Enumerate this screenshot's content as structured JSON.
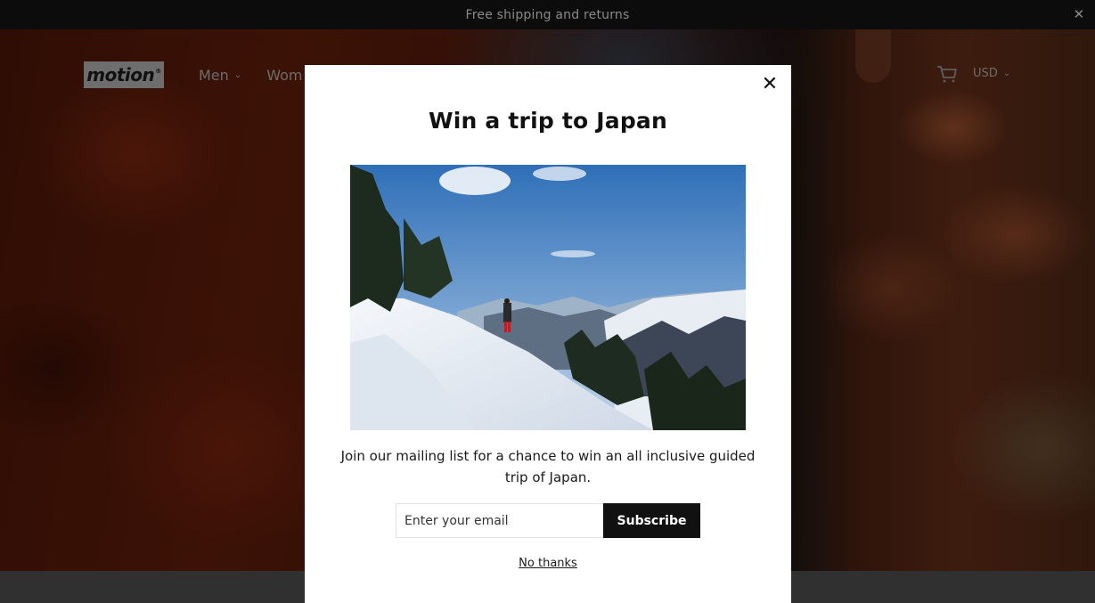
{
  "announcement": {
    "text": "Free shipping and returns",
    "close_icon": "close-icon"
  },
  "header": {
    "logo_text": "motion",
    "logo_mark": "®",
    "nav": [
      {
        "label": "Men",
        "icon": "chevron-down-icon"
      },
      {
        "label": "Wom",
        "icon": ""
      }
    ],
    "cart_icon": "cart-icon",
    "currency": "USD"
  },
  "modal": {
    "title": "Win a trip to Japan",
    "image_alt_icon": "mountain-hiker-photo",
    "description": "Join our mailing list for a chance to win an all inclusive guided trip of Japan.",
    "email_placeholder": "Enter your email",
    "email_value": "",
    "subscribe_label": "Subscribe",
    "dismiss_label": "No thanks",
    "close_icon": "close-icon"
  },
  "colors": {
    "announcement_bg": "#0c0c0c",
    "button_bg": "#111111",
    "modal_bg": "#ffffff"
  }
}
